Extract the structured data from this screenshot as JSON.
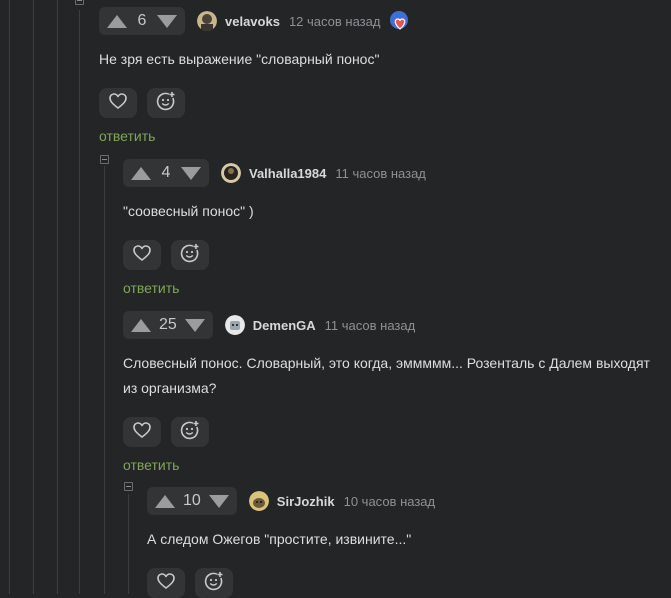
{
  "comments": [
    {
      "rating": "6",
      "user": "velavoks",
      "time": "12 часов назад",
      "text": "Не зря есть выражение \"словарный понос\"",
      "reply": "ответить"
    },
    {
      "rating": "4",
      "user": "Valhalla1984",
      "time": "11 часов назад",
      "text": "\"соовесный понос\" )",
      "reply": "ответить"
    },
    {
      "rating": "25",
      "user": "DemenGA",
      "time": "11 часов назад",
      "text": "Словесный понос. Словарный, это когда, эммммм... Розенталь с Далем выходят из организма?",
      "reply": "ответить"
    },
    {
      "rating": "10",
      "user": "SirJozhik",
      "time": "10 часов назад",
      "text": "А следом Ожегов \"простите, извините...\""
    }
  ],
  "colors": {
    "background": "#242526",
    "accent_green": "#7fa757",
    "control_bg": "#323436",
    "thread_line": "#3c3e40"
  },
  "icons": [
    "arrow-up-icon",
    "arrow-down-icon",
    "heart-icon",
    "add-emoji-icon",
    "collapse-icon"
  ]
}
